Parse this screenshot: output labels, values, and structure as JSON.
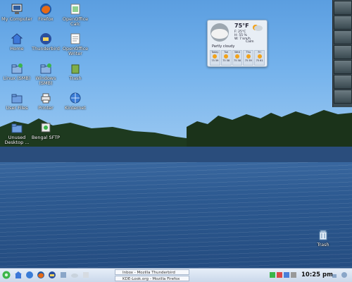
{
  "desktop_icons": [
    {
      "id": "computer",
      "label": "My Computer"
    },
    {
      "id": "firefox",
      "label": "Firefox"
    },
    {
      "id": "openoffice-calc",
      "label": "OpenOffice Calc"
    },
    {
      "id": "home",
      "label": "Home"
    },
    {
      "id": "thunderbird",
      "label": "Thunderbird"
    },
    {
      "id": "openoffice-writer",
      "label": "OpenOffice Writer"
    },
    {
      "id": "linux-share",
      "label": "Linux (SMB)"
    },
    {
      "id": "windows-share",
      "label": "Windows (SMB)"
    },
    {
      "id": "trash-small",
      "label": "Trash"
    },
    {
      "id": "user-files",
      "label": "User Files"
    },
    {
      "id": "printer",
      "label": "Printer"
    },
    {
      "id": "kinternet",
      "label": "Kinternet"
    },
    {
      "id": "unused-desktop",
      "label": "Unused Desktop ..."
    },
    {
      "id": "bengal-sftp",
      "label": "Bengal SFTP"
    },
    {
      "id": "trash",
      "label": "Trash"
    }
  ],
  "weather": {
    "temperature": "75°F",
    "details": [
      "F: 25°C",
      "H: 55 %",
      "W: 7 km/h"
    ],
    "condition": "Partly cloudy",
    "current_label": "Calm",
    "forecast": [
      {
        "day": "Today",
        "range": "75 59"
      },
      {
        "day": "Tue",
        "range": "75 58"
      },
      {
        "day": "Wed",
        "range": "75 58"
      },
      {
        "day": "Thu",
        "range": "75 59"
      },
      {
        "day": "Fri",
        "range": "75 61"
      }
    ]
  },
  "taskbar": {
    "tasks": [
      "Inbox - Mozilla Thunderbird",
      "KDE-Look.org - Mozilla Firefox"
    ],
    "clock": "10:25 pm"
  }
}
